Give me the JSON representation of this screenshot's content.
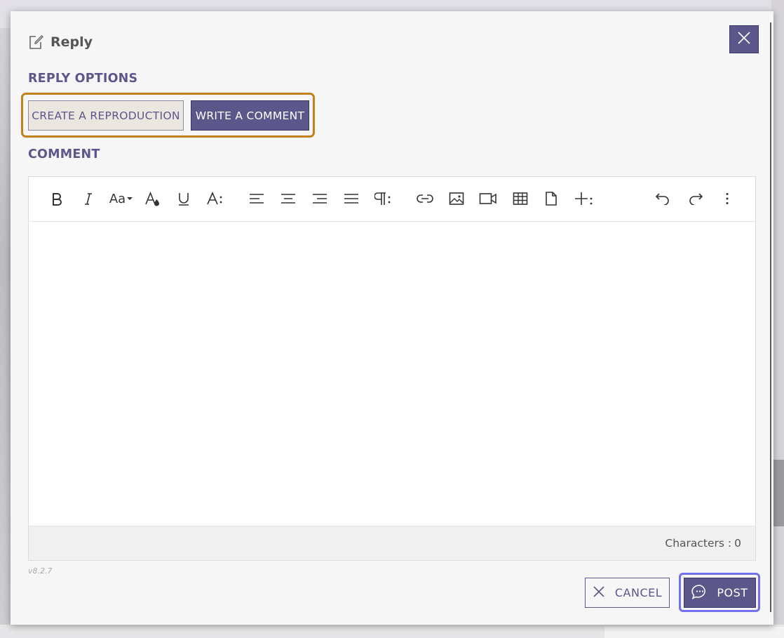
{
  "dialog": {
    "title": "Reply",
    "title_icon": "edit-note-icon",
    "close_icon": "close-icon"
  },
  "reply_options": {
    "label": "REPLY OPTIONS",
    "create_reproduction": "CREATE A REPRODUCTION",
    "write_comment": "WRITE A COMMENT",
    "selected": "WRITE A COMMENT"
  },
  "comment": {
    "label": "COMMENT",
    "toolbar": [
      {
        "name": "bold",
        "icon": "bold-icon"
      },
      {
        "name": "italic",
        "icon": "italic-icon"
      },
      {
        "name": "font-size",
        "icon": "font-size-icon"
      },
      {
        "name": "text-color",
        "icon": "text-color-icon"
      },
      {
        "name": "underline",
        "icon": "underline-icon"
      },
      {
        "name": "more-text",
        "icon": "more-text-icon"
      },
      {
        "name": "align-left",
        "icon": "align-left-icon"
      },
      {
        "name": "align-center",
        "icon": "align-center-icon"
      },
      {
        "name": "align-right",
        "icon": "align-right-icon"
      },
      {
        "name": "align-justify",
        "icon": "align-justify-icon"
      },
      {
        "name": "more-paragraph",
        "icon": "paragraph-icon"
      },
      {
        "name": "insert-link",
        "icon": "link-icon"
      },
      {
        "name": "insert-image",
        "icon": "image-icon"
      },
      {
        "name": "insert-video",
        "icon": "video-icon"
      },
      {
        "name": "insert-table",
        "icon": "table-icon"
      },
      {
        "name": "insert-file",
        "icon": "file-icon"
      },
      {
        "name": "more-insert",
        "icon": "plus-icon"
      },
      {
        "name": "undo",
        "icon": "undo-icon"
      },
      {
        "name": "redo",
        "icon": "redo-icon"
      },
      {
        "name": "more-misc",
        "icon": "more-vertical-icon"
      }
    ],
    "font_size_glyph": "Aa",
    "char_count_label": "Characters :",
    "char_count": "0"
  },
  "version": "v8.2.7",
  "footer": {
    "cancel": "CANCEL",
    "post": "POST",
    "cancel_icon": "close-icon",
    "post_icon": "chat-bubble-icon"
  },
  "colors": {
    "accent": "#5c578a",
    "focus_orange": "#c57f1c",
    "focus_blue": "#7370ee"
  }
}
